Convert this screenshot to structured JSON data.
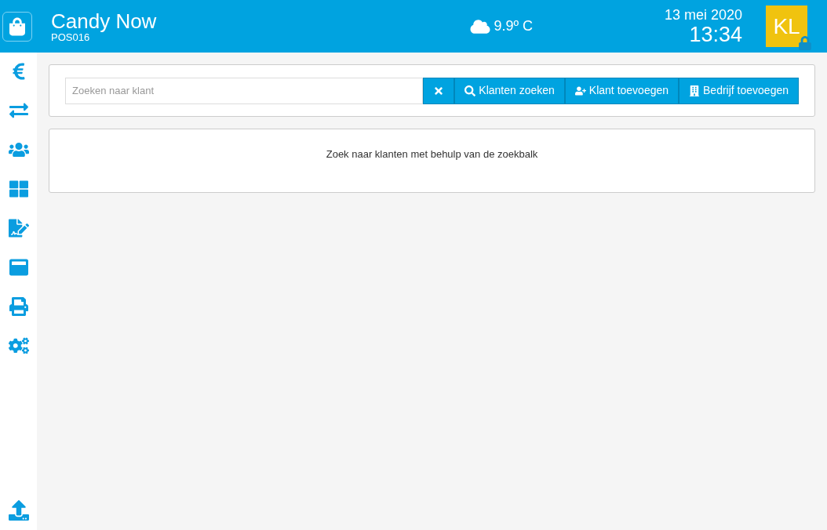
{
  "header": {
    "title": "Candy Now",
    "subtitle": "POS016",
    "weather": "9.9º C",
    "date": "13 mei 2020",
    "time": "13:34",
    "avatar": "KL"
  },
  "search": {
    "placeholder": "Zoeken naar klant",
    "buttons": [
      {
        "kind": "clear"
      },
      {
        "kind": "search",
        "label": "Klanten zoeken"
      },
      {
        "kind": "add-person",
        "label": "Klant toevoegen"
      },
      {
        "kind": "building",
        "label": "Bedrijf toevoegen"
      }
    ]
  },
  "message": "Zoek naar klanten met behulp van de zoekbalk"
}
